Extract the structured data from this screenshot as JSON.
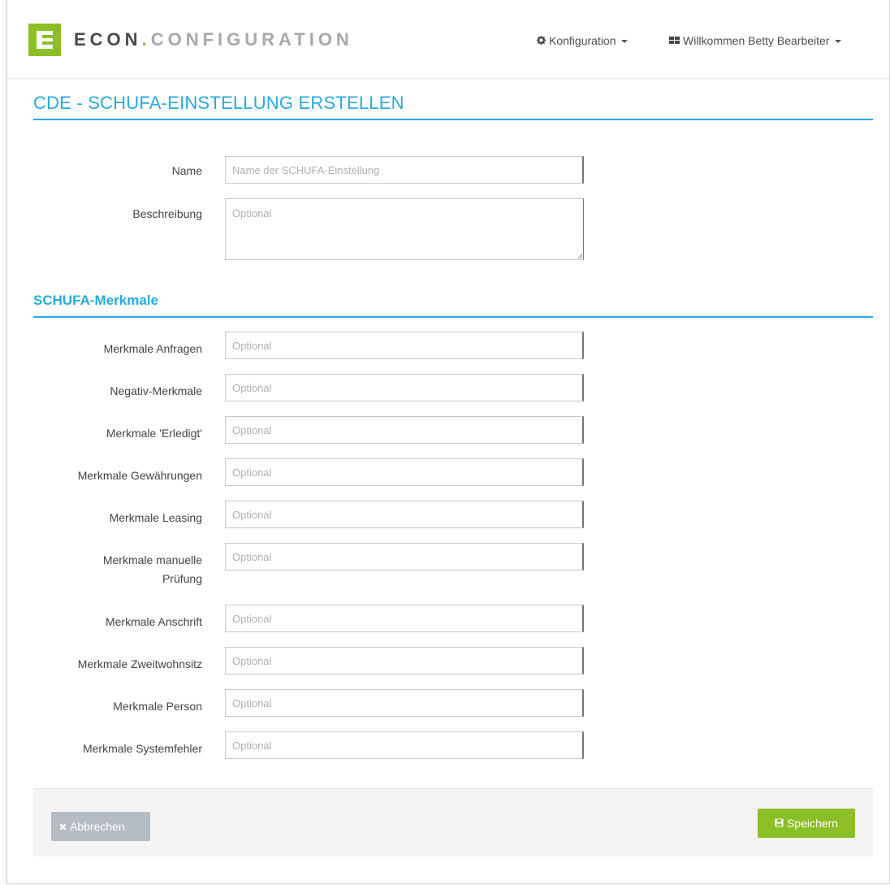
{
  "header": {
    "brand_main": "ECON",
    "brand_dot": ".",
    "brand_sub": "CONFIGURATION",
    "config_menu": "Konfiguration",
    "user_menu": "Willkommen Betty Bearbeiter"
  },
  "page": {
    "title": "CDE - SCHUFA-EINSTELLUNG ERSTELLEN"
  },
  "general": {
    "name_label": "Name",
    "name_placeholder": "Name der SCHUFA-Einstellung",
    "desc_label": "Beschreibung",
    "desc_placeholder": "Optional"
  },
  "section": {
    "title": "SCHUFA-Merkmale",
    "fields": [
      {
        "label": "Merkmale Anfragen",
        "placeholder": "Optional"
      },
      {
        "label": "Negativ-Merkmale",
        "placeholder": "Optional"
      },
      {
        "label": "Merkmale 'Erledigt'",
        "placeholder": "Optional"
      },
      {
        "label": "Merkmale Gewährungen",
        "placeholder": "Optional"
      },
      {
        "label": "Merkmale Leasing",
        "placeholder": "Optional"
      },
      {
        "label": "Merkmale manuelle Prüfung",
        "placeholder": "Optional"
      },
      {
        "label": "Merkmale Anschrift",
        "placeholder": "Optional"
      },
      {
        "label": "Merkmale Zweitwohnsitz",
        "placeholder": "Optional"
      },
      {
        "label": "Merkmale Person",
        "placeholder": "Optional"
      },
      {
        "label": "Merkmale Systemfehler",
        "placeholder": "Optional"
      }
    ]
  },
  "footer": {
    "cancel_label": "Abbrechen",
    "save_label": "Speichern"
  },
  "colors": {
    "accent": "#27aae1",
    "brand_green": "#8cbf26",
    "cancel_gray": "#b5bcc4"
  },
  "icons": {
    "config": "gear-icon",
    "user": "grid-icon",
    "cancel": "close-icon",
    "save": "floppy-disk-icon"
  }
}
